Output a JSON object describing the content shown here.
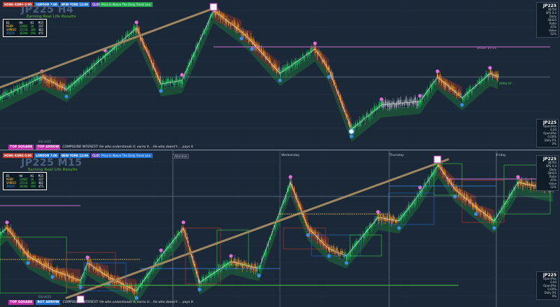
{
  "sessions": [
    {
      "label": "HONG KONG 0:00",
      "color": "#c0392b"
    },
    {
      "label": "LONDON 7:00",
      "color": "#1f6fd1"
    },
    {
      "label": "NEW YORK 12:00",
      "color": "#1f6fd1"
    },
    {
      "label": "CLOSE",
      "color": "#5b3fb0"
    }
  ],
  "info_pills": [
    {
      "label": "Price Is Above The Daily Trend Line",
      "color": "#1fa64a"
    },
    {
      "label": "Price Is Above The Daily Trend Line",
      "color": "#1f6fd1"
    }
  ],
  "top": {
    "title": "JP225 H4",
    "subtitle": "Earning Real Life Results",
    "mini_table": {
      "header": [
        "D1",
        "H4",
        "H1",
        "M15",
        "M5",
        "M1"
      ],
      "rows": [
        {
          "name": "MSDM",
          "vals": [
            "33803",
            "36",
            "137"
          ]
        },
        {
          "name": "SAMEDI",
          "vals": [
            "33518",
            "308",
            "462"
          ]
        },
        {
          "name": "JP225",
          "vals": [
            "38300",
            "198",
            "475"
          ]
        }
      ]
    },
    "side_top": {
      "symbol": "JP225",
      "line1": "38704",
      "line2": "SPS 0.0",
      "line3": "Daily",
      "line4": "38424",
      "line5": "Ratio",
      "line6": "45%",
      "line7": "Value",
      "line8": "52%",
      "line9": "Daily",
      "line10": "0%"
    },
    "side_bottom": {
      "symbol": "JP225",
      "line1": "Open/Pos",
      "line2": "0.00",
      "line3": "Open/Pos",
      "line4": "0.00%",
      "line5": "Daily P/L",
      "line6": "0%",
      "line7": "Daily P/L",
      "line8": "0.00%"
    },
    "level_labels": [
      {
        "text": "ORDER BYTES",
        "color": "#d070d0"
      },
      {
        "text": "OPEN UP",
        "color": "#3ed23e"
      }
    ],
    "version": "EIU v015"
  },
  "bottom": {
    "title": "JP225 M15",
    "subtitle": "Earning Real Life Results",
    "mini_table": {
      "header": [
        "D1",
        "H4",
        "H1",
        "M15",
        "M5",
        "M1"
      ],
      "rows": [
        {
          "name": "MSDM",
          "vals": [
            "33803",
            "36",
            "137"
          ]
        },
        {
          "name": "SAMEDI",
          "vals": [
            "33518",
            "308",
            "462"
          ]
        },
        {
          "name": "JP225",
          "vals": [
            "38300",
            "198",
            "475"
          ]
        }
      ]
    },
    "side_top": {
      "symbol": "JP225",
      "line1": "38704",
      "line2": "SPS 0.0",
      "line3": "Daily",
      "line4": "38424",
      "line5": "Ratio",
      "line6": "45%",
      "line7": "Value",
      "line8": "52%",
      "line9": "Daily",
      "line10": "0%"
    },
    "side_bottom": {
      "symbol": "JP225",
      "line1": "Open/Pos",
      "line2": "0.00",
      "line3": "Open/Pos",
      "line4": "0.00%",
      "line5": "Daily P/L",
      "line6": "0%",
      "line7": "Daily P/L",
      "line8": "0.00%"
    },
    "days": [
      "Wednesday",
      "Thursday",
      "Friday"
    ],
    "version": "EIU v015",
    "tab": "Attention"
  },
  "tags": {
    "top_square": "TOP SQUARE",
    "top_arrow": "TOP ARROW",
    "bot_arrow": "BOT ARROW",
    "compound": "COMPOUND INTEREST: He who understands it, earns it... He who doesn't ... pays it."
  },
  "colors": {
    "bull": "#1fbf5a",
    "bear": "#e8912a",
    "neutral": "#a0a8b0",
    "pivot_high": "#e070d8",
    "pivot_low": "#3a8ee8",
    "trend": "#9e8660",
    "band_green": "#1d6b3a",
    "band_brown": "#6b2f2f"
  }
}
